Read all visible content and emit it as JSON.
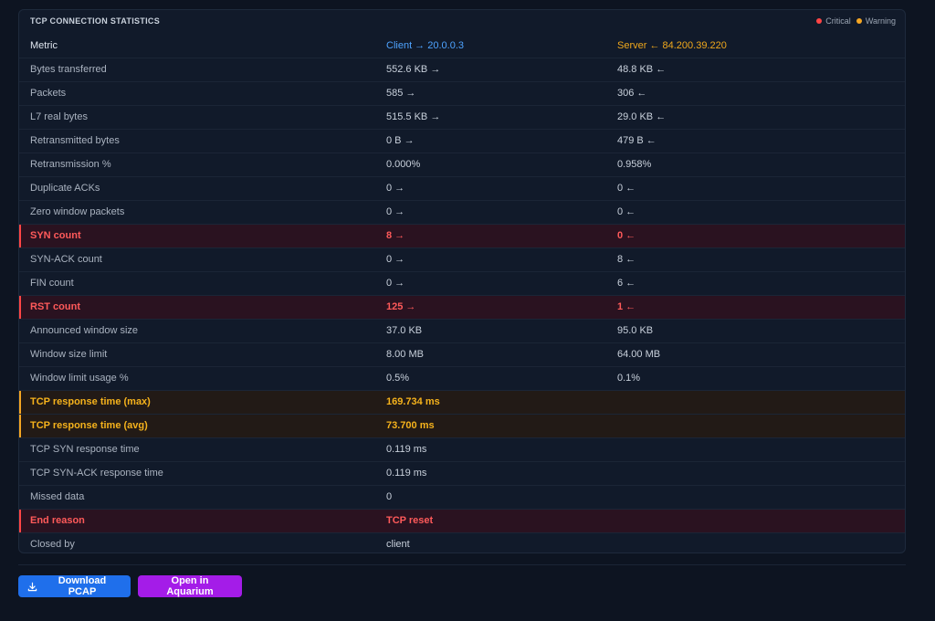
{
  "panel": {
    "title": "TCP CONNECTION STATISTICS",
    "legend": [
      {
        "label": "Critical",
        "color": "#ff4545"
      },
      {
        "label": "Warning",
        "color": "#f5a623"
      }
    ]
  },
  "table": {
    "headers": {
      "metric": "Metric",
      "client": "Client → 20.0.0.3",
      "server": "Server ← 84.200.39.220"
    },
    "rows": [
      {
        "metric": "Bytes transferred",
        "client": "552.6 KB →",
        "server": "48.8 KB ←",
        "level": "normal"
      },
      {
        "metric": "Packets",
        "client": "585 →",
        "server": "306 ←",
        "level": "normal"
      },
      {
        "metric": "L7 real bytes",
        "client": "515.5 KB →",
        "server": "29.0 KB ←",
        "level": "normal"
      },
      {
        "metric": "Retransmitted bytes",
        "client": "0 B →",
        "server": "479 B ←",
        "level": "normal"
      },
      {
        "metric": "Retransmission %",
        "client": "0.000%",
        "server": "0.958%",
        "level": "normal"
      },
      {
        "metric": "Duplicate ACKs",
        "client": "0 →",
        "server": "0 ←",
        "level": "normal"
      },
      {
        "metric": "Zero window packets",
        "client": "0 →",
        "server": "0 ←",
        "level": "normal"
      },
      {
        "metric": "SYN count",
        "client": "8 →",
        "server": "0 ←",
        "level": "critical"
      },
      {
        "metric": "SYN-ACK count",
        "client": "0 →",
        "server": "8 ←",
        "level": "normal"
      },
      {
        "metric": "FIN count",
        "client": "0 →",
        "server": "6 ←",
        "level": "normal"
      },
      {
        "metric": "RST count",
        "client": "125 →",
        "server": "1 ←",
        "level": "critical"
      },
      {
        "metric": "Announced window size",
        "client": "37.0 KB",
        "server": "95.0 KB",
        "level": "normal"
      },
      {
        "metric": "Window size limit",
        "client": "8.00 MB",
        "server": "64.00 MB",
        "level": "normal"
      },
      {
        "metric": "Window limit usage %",
        "client": "0.5%",
        "server": "0.1%",
        "level": "normal"
      },
      {
        "metric": "TCP response time (max)",
        "client": "169.734 ms",
        "server": "",
        "level": "warning"
      },
      {
        "metric": "TCP response time (avg)",
        "client": "73.700 ms",
        "server": "",
        "level": "warning"
      },
      {
        "metric": "TCP SYN response time",
        "client": "0.119 ms",
        "server": "",
        "level": "normal"
      },
      {
        "metric": "TCP SYN-ACK response time",
        "client": "0.119 ms",
        "server": "",
        "level": "normal"
      },
      {
        "metric": "Missed data",
        "client": "0",
        "server": "",
        "level": "normal"
      },
      {
        "metric": "End reason",
        "client": "TCP reset",
        "server": "",
        "level": "critical"
      },
      {
        "metric": "Closed by",
        "client": "client",
        "server": "",
        "level": "normal"
      }
    ]
  },
  "actions": {
    "download_label": "Download PCAP",
    "download_icon": "download-icon",
    "aquarium_label": "Open in Aquarium"
  },
  "colors": {
    "accent_blue": "#1f6feb",
    "accent_purple": "#a41ce8",
    "client": "#4ea3ff",
    "server": "#f0a81c",
    "critical": "#ff4545",
    "warning": "#f5a623"
  }
}
